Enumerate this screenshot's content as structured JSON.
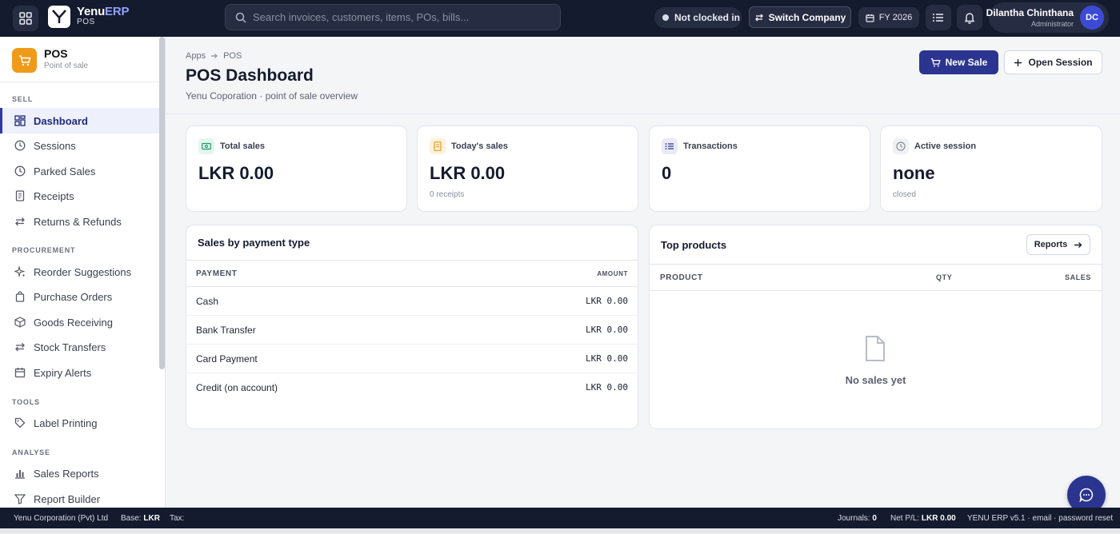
{
  "topbar": {
    "brand_name": "Yenu",
    "brand_name_accent": "ERP",
    "brand_sub": "POS",
    "logo_text": "Yenu",
    "search_placeholder": "Search invoices, customers, items, POs, bills...",
    "clock_status": "Not clocked in",
    "switch_company": "Switch Company",
    "fiscal_year": "FY 2026",
    "user_name": "Dilantha Chinthana",
    "user_role": "Administrator",
    "user_initials": "DC"
  },
  "sidebar": {
    "app_name": "POS",
    "app_sub": "Point of sale",
    "sections": [
      {
        "label": "SELL",
        "items": [
          "Dashboard",
          "Sessions",
          "Parked Sales",
          "Receipts",
          "Returns & Refunds"
        ]
      },
      {
        "label": "PROCUREMENT",
        "items": [
          "Reorder Suggestions",
          "Purchase Orders",
          "Goods Receiving",
          "Stock Transfers",
          "Expiry Alerts"
        ]
      },
      {
        "label": "TOOLS",
        "items": [
          "Label Printing"
        ]
      },
      {
        "label": "ANALYSE",
        "items": [
          "Sales Reports",
          "Report Builder"
        ]
      }
    ],
    "active_item": "Dashboard"
  },
  "header": {
    "breadcrumb": [
      "Apps",
      "POS"
    ],
    "title": "POS Dashboard",
    "subtitle": "Yenu Coporation · point of sale overview",
    "new_sale": "New Sale",
    "open_session": "Open Session"
  },
  "stats": [
    {
      "label": "Total sales",
      "value": "LKR 0.00",
      "hint": "",
      "icon": "cash-icon",
      "color": "#1aa06b"
    },
    {
      "label": "Today's sales",
      "value": "LKR 0.00",
      "hint": "0 receipts",
      "icon": "receipt-icon",
      "color": "#e49a1c"
    },
    {
      "label": "Transactions",
      "value": "0",
      "hint": "",
      "icon": "list-icon",
      "color": "#2b3590"
    },
    {
      "label": "Active session",
      "value": "none",
      "hint": "closed",
      "icon": "clock-icon",
      "color": "#8a8f9c"
    }
  ],
  "payment_panel": {
    "title": "Sales by payment type",
    "col_payment": "PAYMENT",
    "col_amount": "AMOUNT",
    "rows": [
      {
        "payment": "Cash",
        "amount": "LKR 0.00"
      },
      {
        "payment": "Bank Transfer",
        "amount": "LKR 0.00"
      },
      {
        "payment": "Card Payment",
        "amount": "LKR 0.00"
      },
      {
        "payment": "Credit (on account)",
        "amount": "LKR 0.00"
      }
    ]
  },
  "products_panel": {
    "title": "Top products",
    "reports_button": "Reports",
    "col_product": "PRODUCT",
    "col_qty": "QTY",
    "col_sales": "SALES",
    "empty_text": "No sales yet"
  },
  "footer": {
    "company": "Yenu Corporation (Pvt) Ltd",
    "base_label": "Base:",
    "base_value": "LKR",
    "tax_label": "Tax:",
    "journals_label": "Journals:",
    "journals_value": "0",
    "net_label": "Net P/L:",
    "net_value": "LKR 0.00",
    "version": "YENU ERP v5.1 · email · password reset"
  },
  "colors": {
    "topbar": "#141b2e",
    "accent": "#2b3590",
    "app_icon": "#f09a1a"
  }
}
